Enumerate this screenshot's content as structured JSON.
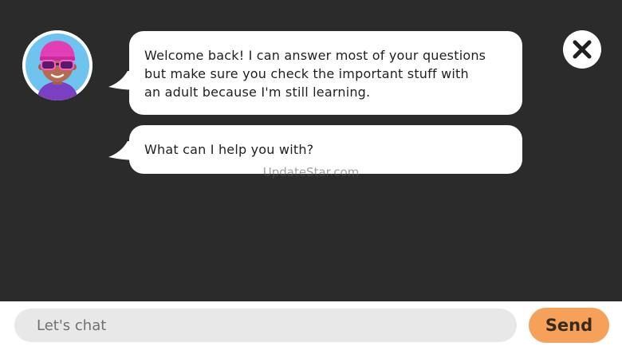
{
  "chat": {
    "messages": [
      {
        "lines": [
          "Welcome back! I can answer most of your questions",
          "but make sure you check the important stuff with",
          "an adult because I'm still learning."
        ]
      },
      {
        "lines": [
          "What can I help you with?"
        ]
      }
    ]
  },
  "watermark": "UpdateStar.com",
  "input": {
    "placeholder": "Let's chat",
    "value": ""
  },
  "send_label": "Send",
  "icons": {
    "avatar": "bot-avatar-icon",
    "close": "close-icon"
  },
  "colors": {
    "background": "#2b2b2b",
    "bubble": "#ffffff",
    "send_button": "#f6a15a",
    "input_field": "#e8e8e8"
  }
}
